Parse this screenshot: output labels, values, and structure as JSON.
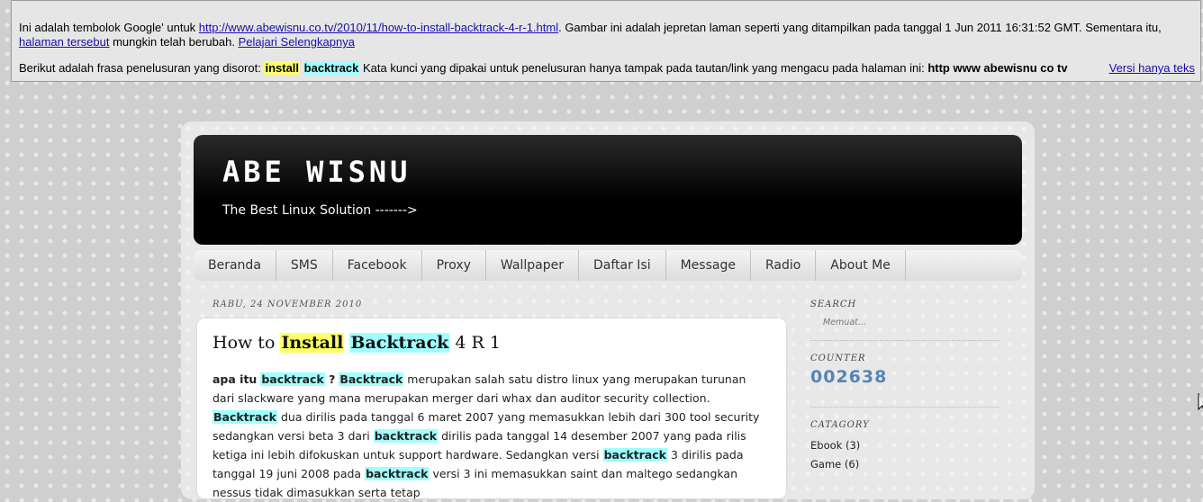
{
  "cache_banner": {
    "line1_prefix": "Ini adalah tembolok Google' untuk ",
    "cached_url": "http://www.abewisnu.co.tv/2010/11/how-to-install-backtrack-4-r-1.html",
    "line1_mid": ". Gambar ini adalah jepretan laman seperti yang ditampilkan pada tanggal 1 Jun 2011 16:31:52 GMT. Sementara itu, ",
    "current_page_link": "halaman tersebut",
    "line1_suffix": " mungkin telah berubah. ",
    "learn_more_link": "Pelajari Selengkapnya",
    "line2_prefix": "Berikut adalah frasa penelusuran yang disorot: ",
    "term1": "install",
    "term2": "backtrack",
    "line2_mid": " Kata kunci yang dipakai untuk penelusuran hanya tampak pada tautan/link yang mengacu pada halaman ini: ",
    "link_keywords": "http www abewisnu co tv",
    "text_only_link": "Versi hanya teks"
  },
  "blog": {
    "title": "ABE WISNU",
    "description": "The Best Linux Solution ------->"
  },
  "nav": [
    "Beranda",
    "SMS",
    "Facebook",
    "Proxy",
    "Wallpaper",
    "Daftar Isi",
    "Message",
    "Radio",
    "About Me"
  ],
  "post": {
    "date": "RABU, 24 NOVEMBER 2010",
    "title_pre": "How to ",
    "title_hl1": "Install",
    "title_sp": " ",
    "title_hl2": "Backtrack",
    "title_post": " 4 R 1",
    "p1": "apa itu",
    "bt": "backtrack",
    "q": " ?",
    "Bt": "Backtrack",
    "s1": " merupakan salah satu distro linux yang merupakan turunan dari slackware yang mana merupakan merger dari whax dan auditor security collection. ",
    "s2": " dua dirilis pada tanggal 6 maret 2007 yang memasukkan lebih dari 300 tool security sedangkan versi beta 3 dari ",
    "s3": " dirilis pada tanggal 14 desember 2007 yang pada rilis ketiga ini lebih difokuskan untuk support hardware. Sedangkan versi ",
    "s4": " 3 dirilis pada tanggal 19 juni 2008 pada ",
    "s5": " versi 3 ini memasukkan saint dan maltego sedangkan nessus tidak dimasukkan serta tetap"
  },
  "sidebar": {
    "search_title": "SEARCH",
    "search_loading": "Memuat...",
    "counter_title": "COUNTER",
    "counter_value": "002638",
    "category_title": "CATAGORY",
    "categories": [
      "Ebook (3)",
      "Game (6)"
    ]
  }
}
